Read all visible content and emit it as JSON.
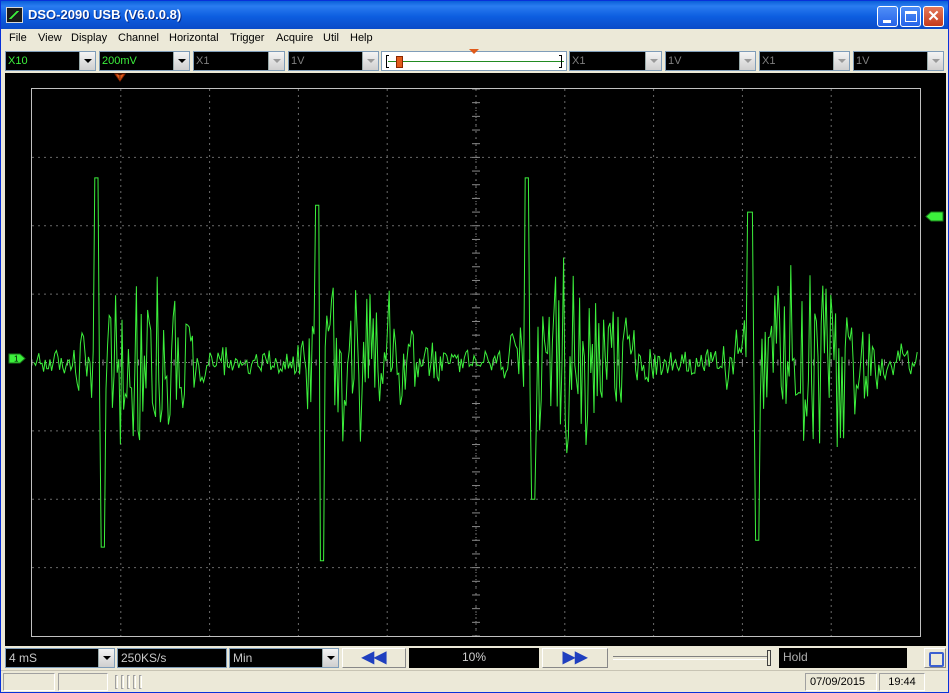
{
  "window": {
    "title": "DSO-2090 USB (V6.0.0.8)"
  },
  "menu": [
    "File",
    "View",
    "Display",
    "Channel",
    "Horizontal",
    "Trigger",
    "Acquire",
    "Util",
    "Help"
  ],
  "channels": [
    {
      "probe": "X10",
      "volts": "200mV"
    },
    {
      "probe": "X1",
      "volts": "1V"
    },
    {
      "probe": "X1",
      "volts": "1V"
    },
    {
      "probe": "X1",
      "volts": "1V"
    }
  ],
  "bottom": {
    "timebase": "4 mS",
    "sample_rate": "250KS/s",
    "mode": "Min",
    "prev_glyph": "◀◀",
    "next_glyph": "▶▶",
    "position_percent": "10%",
    "status": "Hold"
  },
  "statusbar": {
    "date": "07/09/2015",
    "time": "19:44"
  },
  "colors": {
    "trace": "#3cf03c",
    "screen": "#000000",
    "grid": "#6a6a6a",
    "titlebar": "#0a5fd8",
    "trigger_marker": "#e05a1a"
  },
  "icons": {
    "app": "oscilloscope-icon",
    "run": "run-stop-icon"
  },
  "chart_data": {
    "type": "line",
    "title": "",
    "xlabel": "",
    "ylabel": "",
    "grid": true,
    "x_divisions": 10,
    "y_divisions": 8,
    "series": [
      {
        "bursts": [
          {
            "start_div": 0.45,
            "end_div": 2.2,
            "peak_up_div": 2.7,
            "peak_down_div": -2.7
          },
          {
            "start_div": 2.95,
            "end_div": 4.6,
            "peak_up_div": 2.3,
            "peak_down_div": -2.9
          },
          {
            "start_div": 5.3,
            "end_div": 7.1,
            "peak_up_div": 2.7,
            "peak_down_div": -2.0
          },
          {
            "start_div": 7.75,
            "end_div": 9.9,
            "peak_up_div": 2.2,
            "peak_down_div": -2.6
          }
        ]
      }
    ]
  }
}
